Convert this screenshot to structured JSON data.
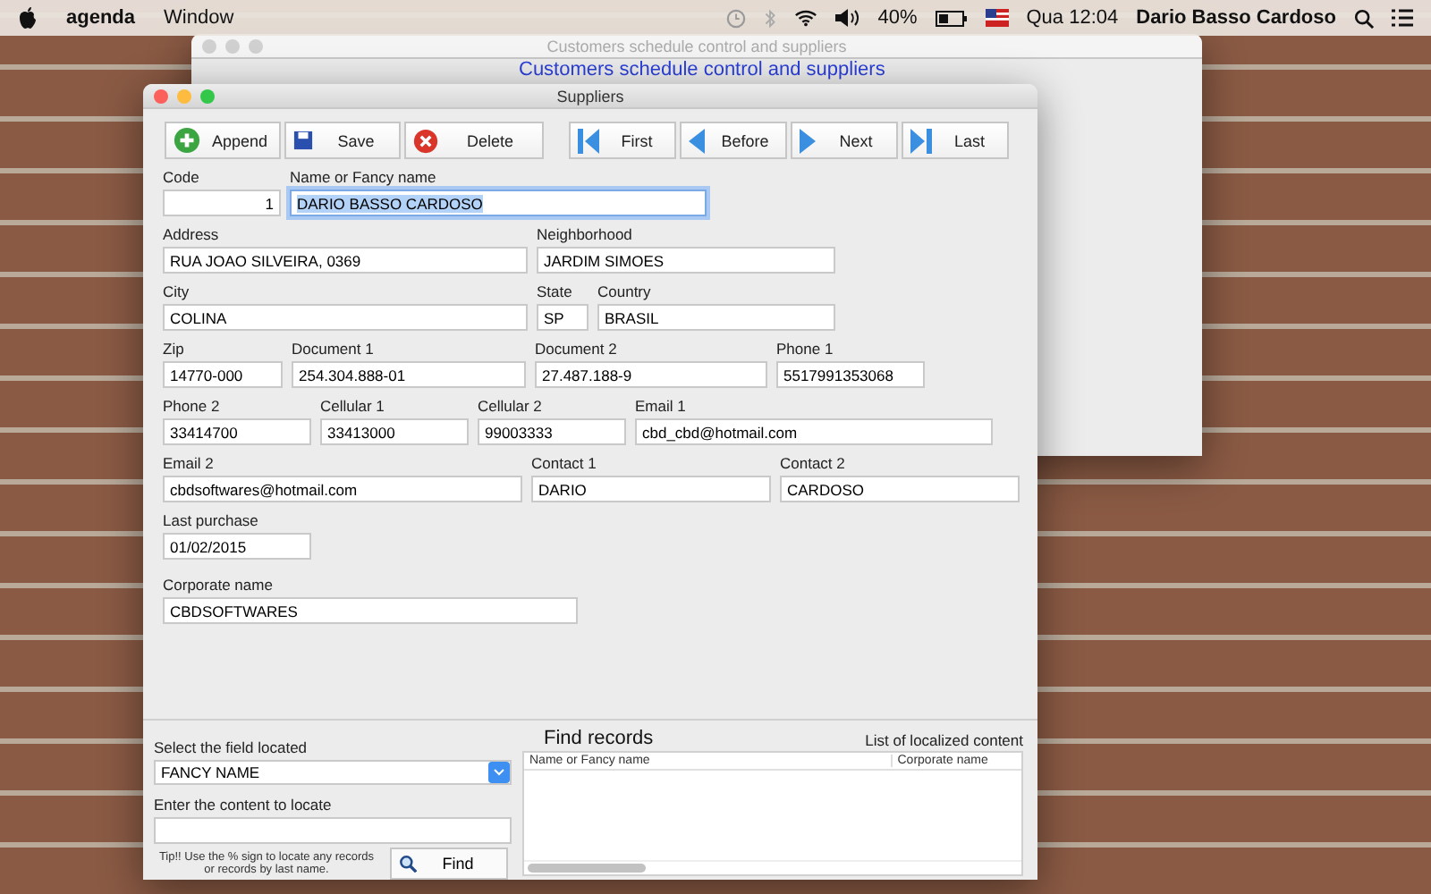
{
  "menu_bar": {
    "app_name": "agenda",
    "menus": [
      "Window"
    ],
    "battery": "40%",
    "clock": "Qua 12:04",
    "user": "Dario Basso Cardoso"
  },
  "back_window": {
    "title": "Customers schedule control and suppliers",
    "heading": "Customers schedule control and suppliers",
    "active": false
  },
  "suppliers_window": {
    "title": "Suppliers",
    "active": true,
    "actions": [
      {
        "label": "Append",
        "kind": "append"
      },
      {
        "label": "Save",
        "kind": "save"
      },
      {
        "label": "Delete",
        "kind": "delete"
      }
    ],
    "navigation": [
      {
        "label": "First",
        "kind": "first"
      },
      {
        "label": "Before",
        "kind": "before"
      },
      {
        "label": "Next",
        "kind": "next"
      },
      {
        "label": "Last",
        "kind": "last"
      }
    ],
    "form_rows": [
      [
        {
          "label": "Code",
          "value": "1",
          "kind": "number",
          "focused": false
        },
        {
          "label": "Name or Fancy name",
          "value": "DARIO BASSO CARDOSO",
          "kind": "text",
          "focused": true
        }
      ],
      [
        {
          "label": "Address",
          "value": "RUA JOAO SILVEIRA, 0369",
          "kind": "text",
          "focused": false
        },
        {
          "label": "Neighborhood",
          "value": "JARDIM SIMOES",
          "kind": "text",
          "focused": false
        }
      ],
      [
        {
          "label": "City",
          "value": "COLINA",
          "kind": "text",
          "focused": false
        },
        {
          "label": "State",
          "value": "SP",
          "kind": "text",
          "focused": false
        },
        {
          "label": "Country",
          "value": "BRASIL",
          "kind": "text",
          "focused": false
        }
      ],
      [
        {
          "label": "Zip",
          "value": "14770-000",
          "kind": "text",
          "focused": false
        },
        {
          "label": "Document 1",
          "value": "254.304.888-01",
          "kind": "text",
          "focused": false
        },
        {
          "label": "Document 2",
          "value": "27.487.188-9",
          "kind": "text",
          "focused": false
        },
        {
          "label": "Phone 1",
          "value": "5517991353068",
          "kind": "text",
          "focused": false
        }
      ],
      [
        {
          "label": "Phone 2",
          "value": "33414700",
          "kind": "text",
          "focused": false
        },
        {
          "label": "Cellular 1",
          "value": "33413000",
          "kind": "text",
          "focused": false
        },
        {
          "label": "Cellular 2",
          "value": "99003333",
          "kind": "text",
          "focused": false
        },
        {
          "label": "Email 1",
          "value": "cbd_cbd@hotmail.com",
          "kind": "text",
          "focused": false
        }
      ],
      [
        {
          "label": "Email 2",
          "value": "cbdsoftwares@hotmail.com",
          "kind": "text",
          "focused": false
        },
        {
          "label": "Contact 1",
          "value": "DARIO",
          "kind": "text",
          "focused": false
        },
        {
          "label": "Contact 2",
          "value": "CARDOSO",
          "kind": "text",
          "focused": false
        }
      ],
      [
        {
          "label": "Last purchase",
          "value": "01/02/2015",
          "kind": "text",
          "focused": false
        }
      ],
      [
        {
          "label": "Corporate name",
          "value": "CBDSOFTWARES",
          "kind": "text",
          "focused": false
        }
      ]
    ],
    "search": {
      "select_label": "Select the field located",
      "select_value": "FANCY NAME",
      "input_label": "Enter the content to locate",
      "tip": "Tip!! Use the % sign to locate any records or records by last name.",
      "find_button": "Find"
    },
    "results": {
      "title": "Find records",
      "caption": "List of localized content",
      "columns": [
        "Name or Fancy name",
        "Corporate name"
      ]
    }
  }
}
